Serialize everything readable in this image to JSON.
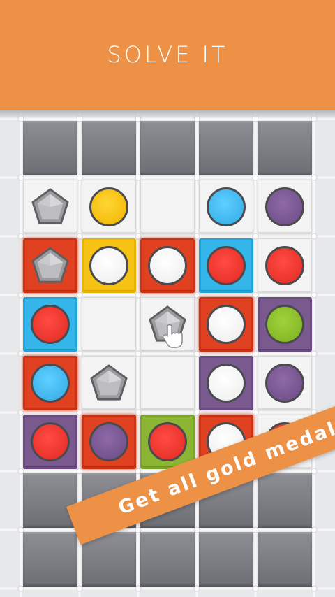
{
  "header": {
    "title": "SOLVE IT"
  },
  "banner": {
    "text": "Get all gold medals!"
  },
  "board": {
    "cols": 5,
    "rows": [
      [
        "empty",
        "empty",
        "empty",
        "empty",
        "empty"
      ],
      [
        {
          "tile": "white",
          "piece": "pentagon"
        },
        {
          "tile": "white",
          "piece": "yellow"
        },
        {
          "tile": "white",
          "piece": ""
        },
        {
          "tile": "white",
          "piece": "blue"
        },
        {
          "tile": "white",
          "piece": "purple"
        }
      ],
      [
        {
          "tile": "red",
          "piece": "pentagon"
        },
        {
          "tile": "yellow",
          "piece": "white"
        },
        {
          "tile": "red",
          "piece": "white"
        },
        {
          "tile": "blue",
          "piece": "red"
        },
        {
          "tile": "white",
          "piece": "red"
        }
      ],
      [
        {
          "tile": "blue",
          "piece": "red"
        },
        {
          "tile": "white",
          "piece": ""
        },
        {
          "tile": "white",
          "piece": "pentagon"
        },
        {
          "tile": "red",
          "piece": "white"
        },
        {
          "tile": "purple",
          "piece": "green"
        }
      ],
      [
        {
          "tile": "red",
          "piece": "blue"
        },
        {
          "tile": "white",
          "piece": "pentagon"
        },
        {
          "tile": "white",
          "piece": ""
        },
        {
          "tile": "purple",
          "piece": "white"
        },
        {
          "tile": "white",
          "piece": "purple"
        }
      ],
      [
        {
          "tile": "purple",
          "piece": "red"
        },
        {
          "tile": "red",
          "piece": "purple"
        },
        {
          "tile": "green",
          "piece": "red"
        },
        {
          "tile": "red",
          "piece": "white"
        },
        {
          "tile": "white",
          "piece": "red"
        }
      ],
      [
        "empty",
        "empty",
        "empty",
        "empty",
        "empty"
      ],
      [
        "empty",
        "empty",
        "empty",
        "empty",
        "empty"
      ]
    ],
    "hint": {
      "icon": "hand-pointer-icon",
      "row": 3,
      "col": 2
    }
  },
  "colors": {
    "accent": "#ec9146",
    "board_bg": "#e7e8ea",
    "empty_cell": "#7b7d83"
  }
}
